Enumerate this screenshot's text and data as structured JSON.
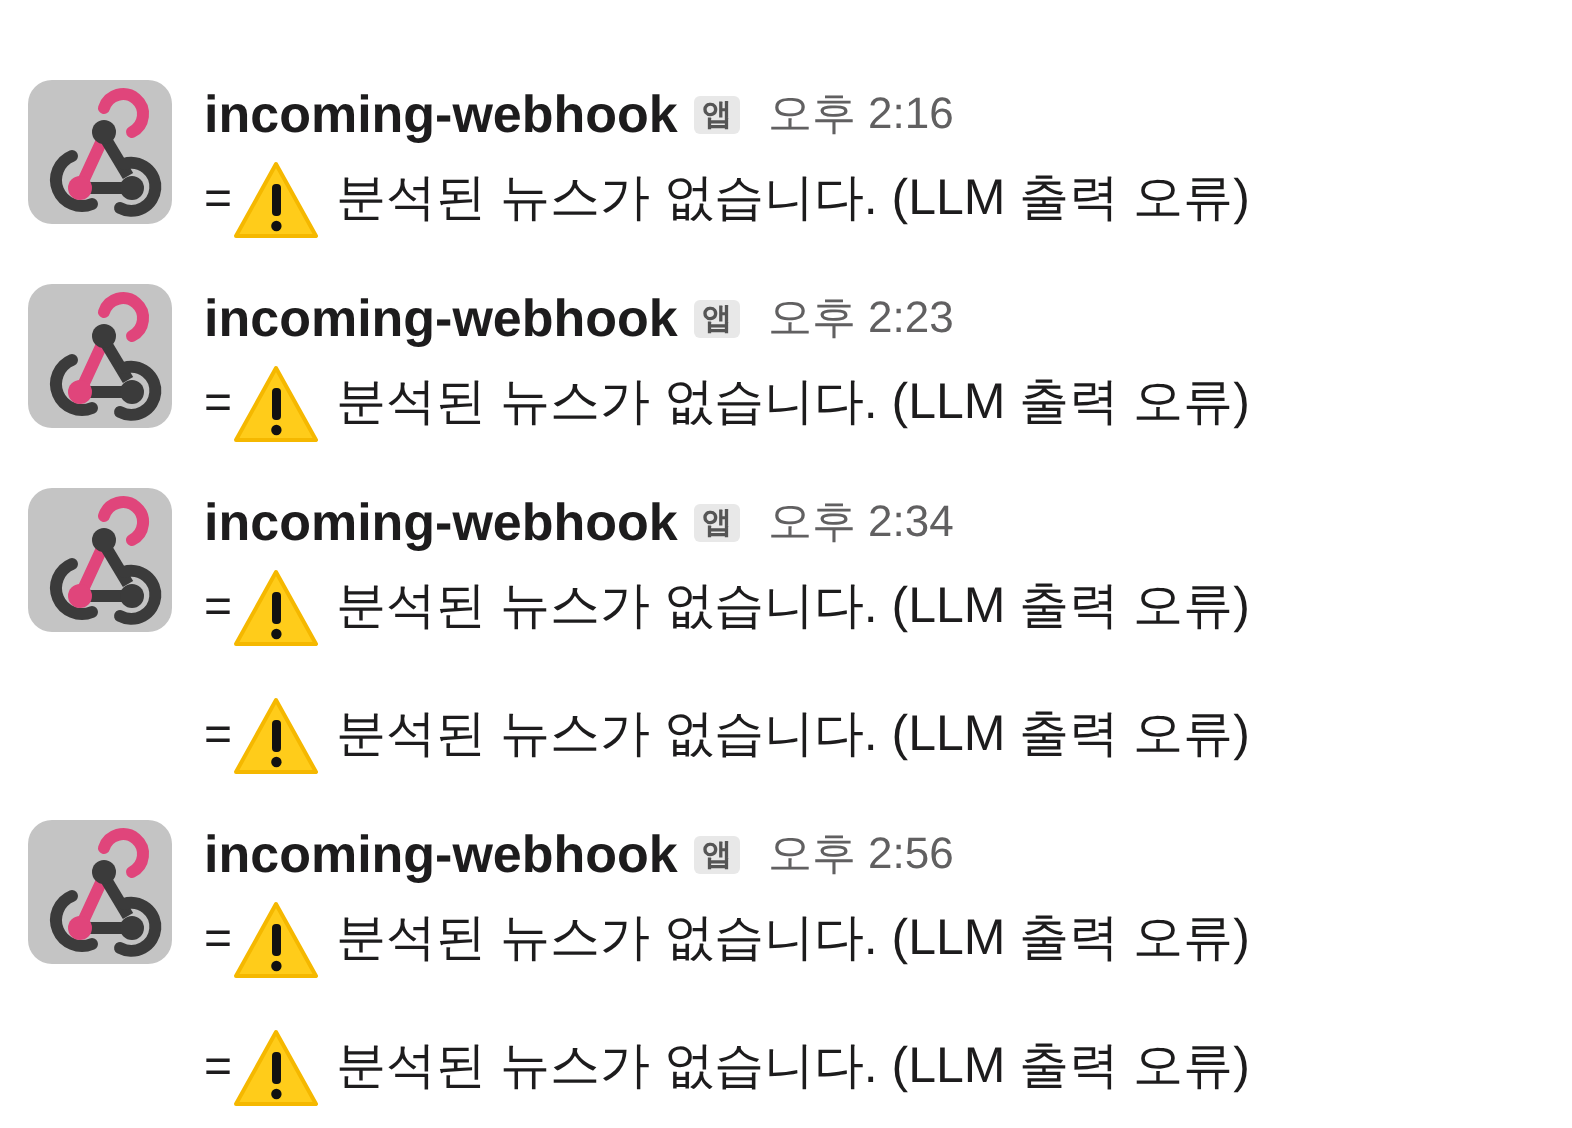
{
  "messages": [
    {
      "sender": "incoming-webhook",
      "badge": "앱",
      "time": "오후 2:16",
      "lines": [
        {
          "prefix": "=",
          "text": "분석된 뉴스가 없습니다. (LLM 출력 오류)"
        }
      ]
    },
    {
      "sender": "incoming-webhook",
      "badge": "앱",
      "time": "오후 2:23",
      "lines": [
        {
          "prefix": "=",
          "text": "분석된 뉴스가 없습니다. (LLM 출력 오류)"
        }
      ]
    },
    {
      "sender": "incoming-webhook",
      "badge": "앱",
      "time": "오후 2:34",
      "lines": [
        {
          "prefix": "=",
          "text": "분석된 뉴스가 없습니다. (LLM 출력 오류)"
        },
        {
          "prefix": "=",
          "text": "분석된 뉴스가 없습니다. (LLM 출력 오류)"
        }
      ]
    },
    {
      "sender": "incoming-webhook",
      "badge": "앱",
      "time": "오후 2:56",
      "lines": [
        {
          "prefix": "=",
          "text": "분석된 뉴스가 없습니다. (LLM 출력 오류)"
        },
        {
          "prefix": "=",
          "text": "분석된 뉴스가 없습니다. (LLM 출력 오류)"
        }
      ]
    }
  ]
}
